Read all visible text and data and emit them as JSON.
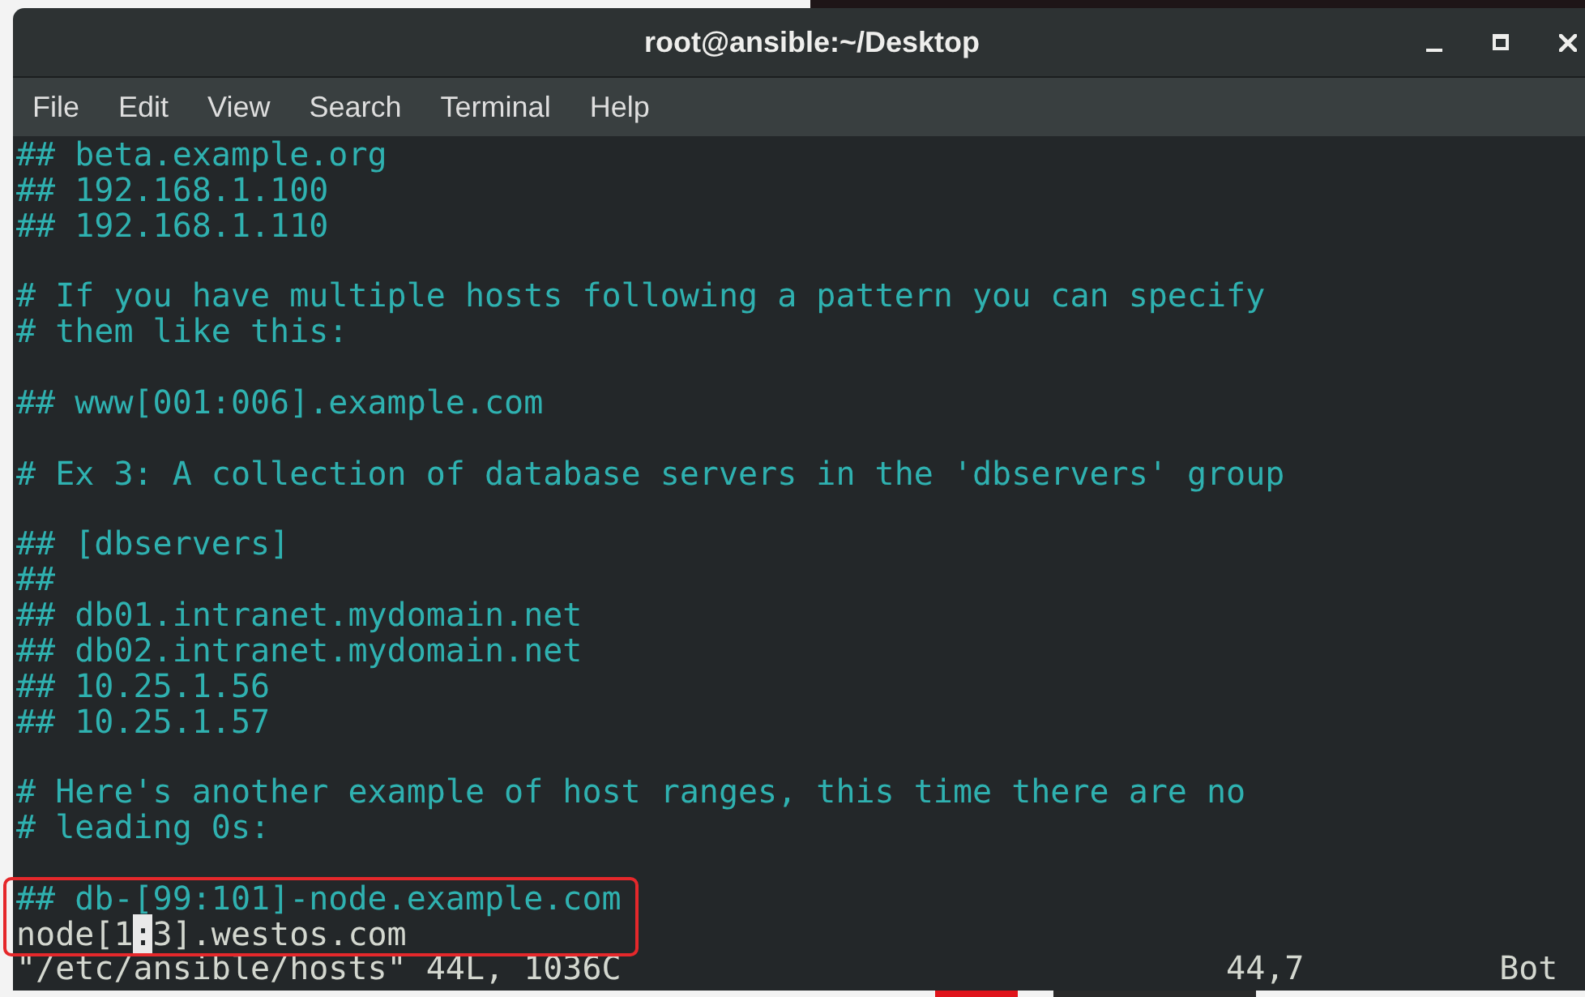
{
  "window": {
    "title": "root@ansible:~/Desktop",
    "controls": [
      {
        "kind": "minimize"
      },
      {
        "kind": "maximize"
      },
      {
        "kind": "close"
      }
    ]
  },
  "menu": [
    "File",
    "Edit",
    "View",
    "Search",
    "Terminal",
    "Help"
  ],
  "terminal": {
    "lines": [
      {
        "kind": "comment",
        "text": "## beta.example.org"
      },
      {
        "kind": "comment",
        "text": "## 192.168.1.100"
      },
      {
        "kind": "comment",
        "text": "## 192.168.1.110"
      },
      {
        "kind": "blank"
      },
      {
        "kind": "comment",
        "text": "# If you have multiple hosts following a pattern you can specify"
      },
      {
        "kind": "comment",
        "text": "# them like this:"
      },
      {
        "kind": "blank"
      },
      {
        "kind": "comment",
        "text": "## www[001:006].example.com"
      },
      {
        "kind": "blank"
      },
      {
        "kind": "comment",
        "text": "# Ex 3: A collection of database servers in the 'dbservers' group"
      },
      {
        "kind": "blank"
      },
      {
        "kind": "comment",
        "text": "## [dbservers]"
      },
      {
        "kind": "comment",
        "text": "##"
      },
      {
        "kind": "comment",
        "text": "## db01.intranet.mydomain.net"
      },
      {
        "kind": "comment",
        "text": "## db02.intranet.mydomain.net"
      },
      {
        "kind": "comment",
        "text": "## 10.25.1.56"
      },
      {
        "kind": "comment",
        "text": "## 10.25.1.57"
      },
      {
        "kind": "blank"
      },
      {
        "kind": "comment",
        "text": "# Here's another example of host ranges, this time there are no"
      },
      {
        "kind": "comment",
        "text": "# leading 0s:"
      },
      {
        "kind": "blank"
      },
      {
        "kind": "comment",
        "text": "## db-[99:101]-node.example.com"
      },
      {
        "kind": "cursor_line",
        "text_before_cursor": "node[1",
        "cursor_char": ":",
        "text_after_cursor": "3].westos.com"
      }
    ],
    "status_line": {
      "message": "\"/etc/ansible/hosts\" 44L, 1036C",
      "ruler": "44,7",
      "position": "Bot"
    }
  },
  "annotation_box": true
}
